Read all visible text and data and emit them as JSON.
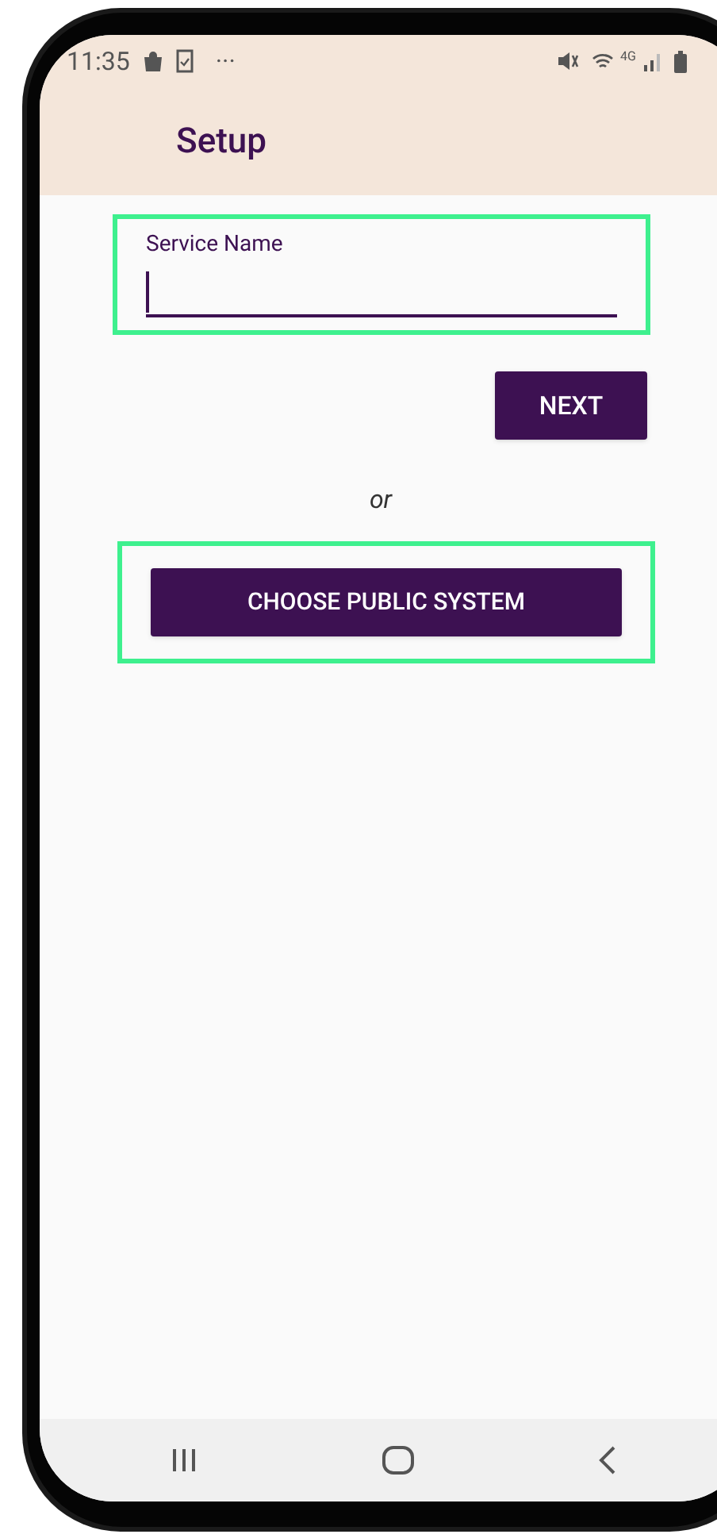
{
  "status_bar": {
    "time": "11:35",
    "more": "···",
    "network": "4G"
  },
  "app_bar": {
    "title": "Setup"
  },
  "field": {
    "label": "Service Name",
    "focused": true,
    "highlighted": true
  },
  "buttons": [
    {
      "label": "NEXT",
      "kind": "small"
    },
    {
      "kind": "divider_text",
      "label": "or"
    },
    {
      "label": "CHOOSE PUBLIC SYSTEM",
      "kind": "wide",
      "highlighted": true
    }
  ]
}
